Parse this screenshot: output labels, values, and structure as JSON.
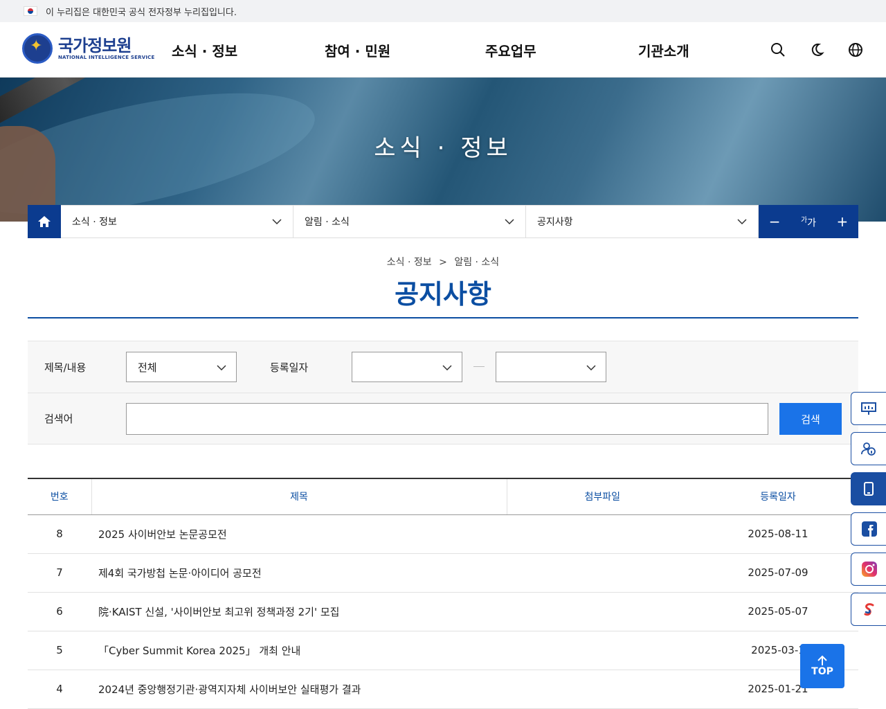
{
  "gov_banner": {
    "text": "이 누리집은 대한민국 공식 전자정부 누리집입니다."
  },
  "logo": {
    "name": "국가정보원",
    "name_en": "NATIONAL INTELLIGENCE SERVICE"
  },
  "gnb": [
    "소식 · 정보",
    "참여 · 민원",
    "주요업무",
    "기관소개"
  ],
  "header_icons": [
    "search-icon",
    "moon-icon",
    "globe-icon"
  ],
  "hero": {
    "title": "소식 · 정보"
  },
  "location": {
    "depth1": "소식 · 정보",
    "depth2": "알림 · 소식",
    "depth3": "공지사항"
  },
  "font_control": {
    "minus": "−",
    "label_small": "가",
    "label_large": "가",
    "plus": "+"
  },
  "breadcrumb": {
    "first": "소식 · 정보",
    "sep": ">",
    "second": "알림 · 소식"
  },
  "page_title": "공지사항",
  "search": {
    "field_label": "제목/내용",
    "field_value": "전체",
    "date_label": "등록일자",
    "date_from": "",
    "date_to": "",
    "keyword_label": "검색어",
    "keyword_value": "",
    "button": "검색"
  },
  "table": {
    "headers": [
      "번호",
      "제목",
      "첨부파일",
      "등록일자"
    ],
    "rows": [
      {
        "no": "8",
        "title": "2025 사이버안보 논문공모전",
        "file": "",
        "date": "2025-08-11"
      },
      {
        "no": "7",
        "title": "제4회 국가방첩 논문·아이디어 공모전",
        "file": "",
        "date": "2025-07-09"
      },
      {
        "no": "6",
        "title": "院·KAIST 신설, '사이버안보 최고위 정책과정 2기' 모집",
        "file": "",
        "date": "2025-05-07"
      },
      {
        "no": "5",
        "title": "「Cyber Summit Korea 2025」 개최 안내",
        "file": "",
        "date": "2025-03-1"
      },
      {
        "no": "4",
        "title": "2024년 중앙행정기관·광역지자체 사이버보안 실태평가 결과",
        "file": "",
        "date": "2025-01-21"
      }
    ]
  },
  "quick_menu": [
    "presentation-icon",
    "info-person-icon",
    "mobile-icon",
    "facebook-icon",
    "instagram-icon",
    "sns-icon"
  ],
  "top_button": {
    "label": "TOP"
  },
  "colors": {
    "primary": "#0b3b8f",
    "accent": "#1a73e8",
    "title": "#0b4ea2"
  }
}
